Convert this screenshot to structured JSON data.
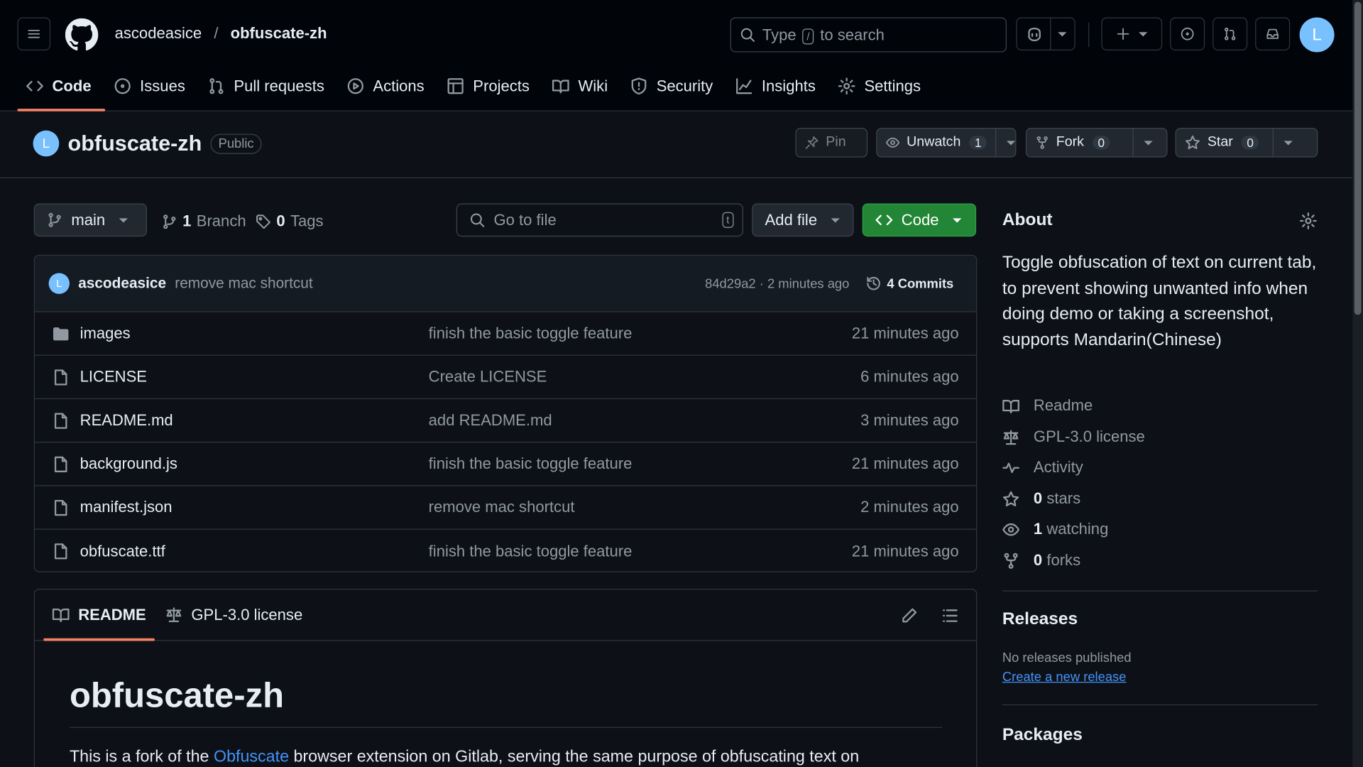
{
  "header": {
    "owner": "ascodeasice",
    "separator": "/",
    "repo": "obfuscate-zh",
    "search_prefix": "Type",
    "search_key": "/",
    "search_suffix": "to search",
    "avatar_letter": "L"
  },
  "tabs": [
    {
      "label": "Code",
      "icon": "code-icon"
    },
    {
      "label": "Issues",
      "icon": "issue-icon"
    },
    {
      "label": "Pull requests",
      "icon": "pull-request-icon"
    },
    {
      "label": "Actions",
      "icon": "play-icon"
    },
    {
      "label": "Projects",
      "icon": "table-icon"
    },
    {
      "label": "Wiki",
      "icon": "book-icon"
    },
    {
      "label": "Security",
      "icon": "shield-icon"
    },
    {
      "label": "Insights",
      "icon": "graph-icon"
    },
    {
      "label": "Settings",
      "icon": "gear-icon"
    }
  ],
  "repo": {
    "name": "obfuscate-zh",
    "visibility": "Public",
    "avatar_letter": "L",
    "pin_label": "Pin",
    "unwatch_label": "Unwatch",
    "watch_count": "1",
    "fork_label": "Fork",
    "fork_count": "0",
    "star_label": "Star",
    "star_count": "0"
  },
  "toolbar": {
    "branch": "main",
    "branch_count": "1",
    "branch_label": "Branch",
    "tag_count": "0",
    "tag_label": "Tags",
    "goto_placeholder": "Go to file",
    "goto_key": "t",
    "add_file_label": "Add file",
    "code_label": "Code"
  },
  "commit": {
    "avatar_letter": "L",
    "author": "ascodeasice",
    "message": "remove mac shortcut",
    "hash_time": "84d29a2 · 2 minutes ago",
    "commits_label": "4 Commits"
  },
  "files": [
    {
      "name": "images",
      "type": "folder",
      "message": "finish the basic toggle feature",
      "age": "21 minutes ago"
    },
    {
      "name": "LICENSE",
      "type": "file",
      "message": "Create LICENSE",
      "age": "6 minutes ago"
    },
    {
      "name": "README.md",
      "type": "file",
      "message": "add README.md",
      "age": "3 minutes ago"
    },
    {
      "name": "background.js",
      "type": "file",
      "message": "finish the basic toggle feature",
      "age": "21 minutes ago"
    },
    {
      "name": "manifest.json",
      "type": "file",
      "message": "remove mac shortcut",
      "age": "2 minutes ago"
    },
    {
      "name": "obfuscate.ttf",
      "type": "file",
      "message": "finish the basic toggle feature",
      "age": "21 minutes ago"
    }
  ],
  "readme": {
    "tab_readme": "README",
    "tab_license": "GPL-3.0 license",
    "heading": "obfuscate-zh",
    "para_before": "This is a fork of the",
    "para_link": "Obfuscate",
    "para_after": "browser extension on Gitlab, serving the same purpose of obfuscating text on"
  },
  "about": {
    "title": "About",
    "description": "Toggle obfuscation of text on current tab, to prevent showing unwanted info when doing demo or taking a screenshot, supports Mandarin(Chinese)",
    "readme": "Readme",
    "license": "GPL-3.0 license",
    "activity": "Activity",
    "stars_count": "0",
    "stars_label": "stars",
    "watching_count": "1",
    "watching_label": "watching",
    "forks_count": "0",
    "forks_label": "forks"
  },
  "releases": {
    "title": "Releases",
    "none": "No releases published",
    "create": "Create a new release"
  },
  "packages": {
    "title": "Packages"
  }
}
